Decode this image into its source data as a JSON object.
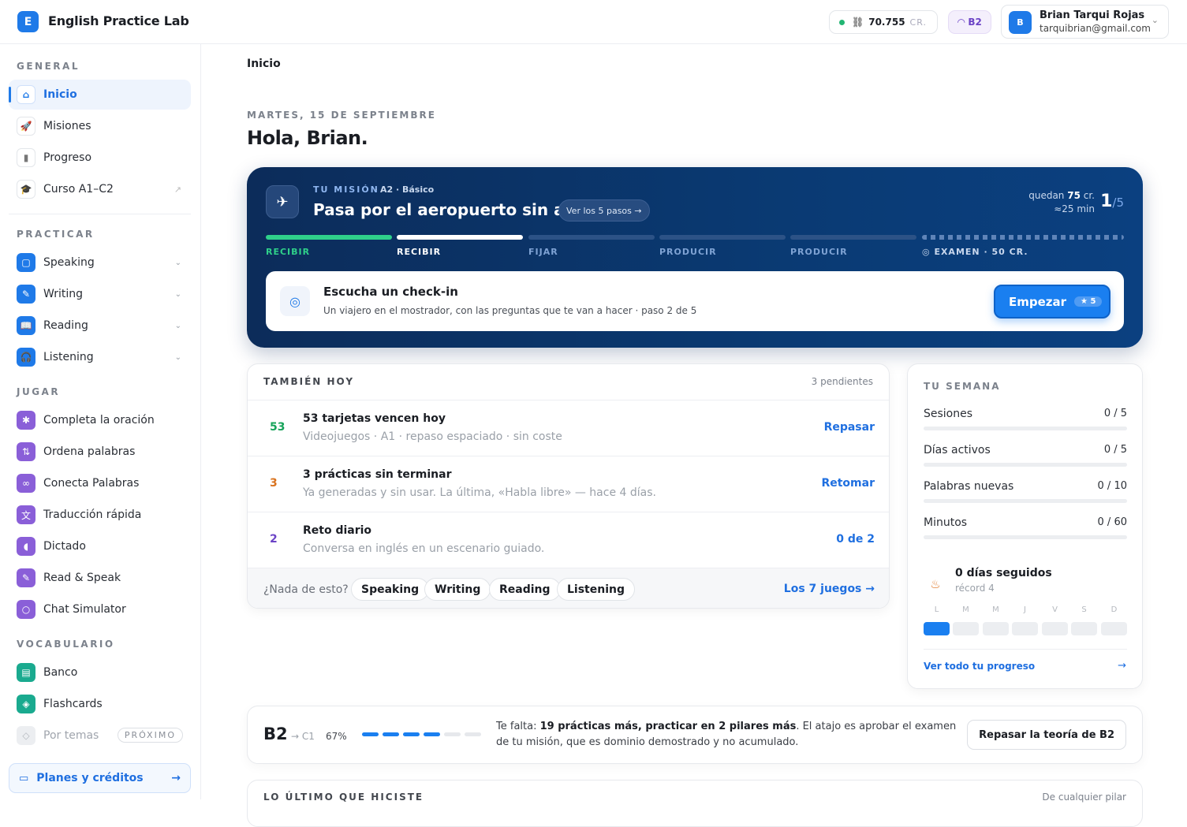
{
  "app": {
    "logo_letter": "E",
    "name": "English Practice Lab"
  },
  "header": {
    "credits_value": "70.755",
    "credits_unit": "CR.",
    "level": "B2",
    "user_initial": "B",
    "user_name": "Brian Tarqui Rojas",
    "user_email": "tarquibrian@gmail.com"
  },
  "sidebar": {
    "general_label": "GENERAL",
    "general": [
      {
        "label": "Inicio",
        "icon": "home-icon",
        "active": true
      },
      {
        "label": "Misiones",
        "icon": "rocket-icon"
      },
      {
        "label": "Progreso",
        "icon": "bar-chart-icon"
      },
      {
        "label": "Curso A1–C2",
        "icon": "graduation-cap-icon"
      }
    ],
    "practicar_label": "PRACTICAR",
    "practicar": [
      {
        "label": "Speaking",
        "icon": "chat-icon"
      },
      {
        "label": "Writing",
        "icon": "pencil-icon"
      },
      {
        "label": "Reading",
        "icon": "book-icon"
      },
      {
        "label": "Listening",
        "icon": "headphones-icon"
      }
    ],
    "jugar_label": "JUGAR",
    "jugar": [
      {
        "label": "Completa la oración",
        "icon": "puzzle-icon"
      },
      {
        "label": "Ordena palabras",
        "icon": "sort-icon"
      },
      {
        "label": "Conecta Palabras",
        "icon": "link-icon"
      },
      {
        "label": "Traducción rápida",
        "icon": "translate-icon"
      },
      {
        "label": "Dictado",
        "icon": "speaker-icon"
      },
      {
        "label": "Read & Speak",
        "icon": "mic-icon"
      },
      {
        "label": "Chat Simulator",
        "icon": "message-icon"
      }
    ],
    "vocab_label": "VOCABULARIO",
    "vocab": [
      {
        "label": "Banco",
        "icon": "bookmark-book-icon"
      },
      {
        "label": "Flashcards",
        "icon": "layers-icon"
      },
      {
        "label": "Por temas",
        "icon": "tag-icon",
        "badge": "PRÓXIMO"
      }
    ],
    "plans_label": "Planes y créditos"
  },
  "main": {
    "breadcrumb": "Inicio",
    "date": "MARTES, 15 DE SEPTIEMBRE",
    "greeting": "Hola, Brian."
  },
  "mission": {
    "label": "TU MISIÓN",
    "level": "A2 · Básico",
    "title": "Pasa por el aeropuerto sin ayuda",
    "steps_button": "Ver los 5 pasos →",
    "remaining_prefix": "quedan ",
    "remaining_credits": "75",
    "remaining_suffix": " cr.",
    "remaining_time": "≈25 min",
    "step_current": "1",
    "step_total": "/5",
    "steps": [
      "RECIBIR",
      "RECIBIR",
      "FIJAR",
      "PRODUCIR",
      "PRODUCIR",
      "EXAMEN · 50 CR."
    ],
    "task_title": "Escucha un check-in",
    "task_sub": "Un viajero en el mostrador, con las preguntas que te van a hacer · paso 2 de 5",
    "start_label": "Empezar",
    "start_reward": "5"
  },
  "also_today": {
    "title": "TAMBIÉN HOY",
    "pending": "3 pendientes",
    "rows": [
      {
        "num": "53",
        "color": "#17a35a",
        "title": "53 tarjetas vencen hoy",
        "sub": "Videojuegos · A1 · repaso espaciado · sin coste",
        "action": "Repasar"
      },
      {
        "num": "3",
        "color": "#d9731f",
        "title": "3 prácticas sin terminar",
        "sub": "Ya generadas y sin usar. La última, «Habla libre» — hace 4 días.",
        "action": "Retomar"
      },
      {
        "num": "2",
        "color": "#6b43c6",
        "title": "Reto diario",
        "sub": "Conversa en inglés en un escenario guiado.",
        "action": "0 de 2"
      }
    ],
    "footer_q": "¿Nada de esto?",
    "chips": [
      "Speaking",
      "Writing",
      "Reading",
      "Listening"
    ],
    "all_games": "Los 7 juegos →"
  },
  "week": {
    "title": "TU SEMANA",
    "rows": [
      {
        "label": "Sesiones",
        "value": "0 / 5"
      },
      {
        "label": "Días activos",
        "value": "0 / 5"
      },
      {
        "label": "Palabras nuevas",
        "value": "0 / 10"
      },
      {
        "label": "Minutos",
        "value": "0 / 60"
      }
    ],
    "streak": "0 días seguidos",
    "record": "récord 4",
    "days": [
      "L",
      "M",
      "M",
      "J",
      "V",
      "S",
      "D"
    ],
    "progress_link": "Ver todo tu progreso"
  },
  "level_card": {
    "current": "B2",
    "next": "→ C1",
    "percent": "67%",
    "segments_filled": 4,
    "segments_total": 6,
    "text_prefix": "Te falta: ",
    "text_bold": "19 prácticas más, practicar en 2 pilares más",
    "text_suffix": ". El atajo es aprobar el examen de tu misión, que es dominio demostrado y no acumulado.",
    "button": "Repasar la teoría de B2"
  },
  "last": {
    "title": "LO ÚLTIMO QUE HICISTE",
    "any": "De cualquier pilar"
  },
  "colors": {
    "accent": "#1f7ae8",
    "mission_bg": "#0a3a73",
    "green": "#22b573"
  }
}
